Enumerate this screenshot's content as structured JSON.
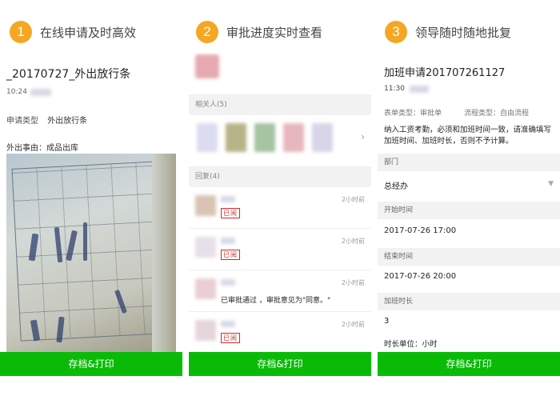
{
  "steps": [
    {
      "number": "1",
      "title": "在线申请及时高效"
    },
    {
      "number": "2",
      "title": "审批进度实时查看"
    },
    {
      "number": "3",
      "title": "领导随时随地批复"
    }
  ],
  "panel1": {
    "doc_title": "_20170727_外出放行条",
    "time": "10:24",
    "type_key": "申请类型",
    "type_value": "外出放行条",
    "reason": "外出事由：成品出库",
    "action_label": "存档&打印"
  },
  "panel2": {
    "related_label": "相关人(5)",
    "reply_label": "回复(4)",
    "chevron": "›",
    "replies": [
      {
        "time": "2小时前",
        "stamp": "已阅",
        "message": ""
      },
      {
        "time": "2小时前",
        "stamp": "已阅",
        "message": ""
      },
      {
        "time": "2小时前",
        "stamp": "",
        "message": "已审批通过 ，审批意见为\"同意。\""
      },
      {
        "time": "2小时前",
        "stamp": "已阅",
        "message": ""
      }
    ],
    "action_label": "存档&打印"
  },
  "panel3": {
    "title": "加班申请201707261127",
    "time": "11:30",
    "form_type": "表单类型：审批单",
    "flow_type": "流程类型：自由流程",
    "notice": "纳入工资考勤，必须和加班时间一致，请准确填写加班时间、加班时长，否则不予计算。",
    "fields": [
      {
        "label": "部门",
        "value": "总经办",
        "dropdown": true
      },
      {
        "label": "开始时间",
        "value": "2017-07-26 17:00"
      },
      {
        "label": "结束时间",
        "value": "2017-07-26 20:00"
      },
      {
        "label": "加班时长",
        "value": "3"
      }
    ],
    "caret": "▼",
    "unit": "时长单位：小时",
    "action_label": "存档&打印"
  },
  "colors": {
    "accent_orange": "#f5a623",
    "action_green": "#09bb07",
    "stamp_red": "#d02b2b"
  }
}
